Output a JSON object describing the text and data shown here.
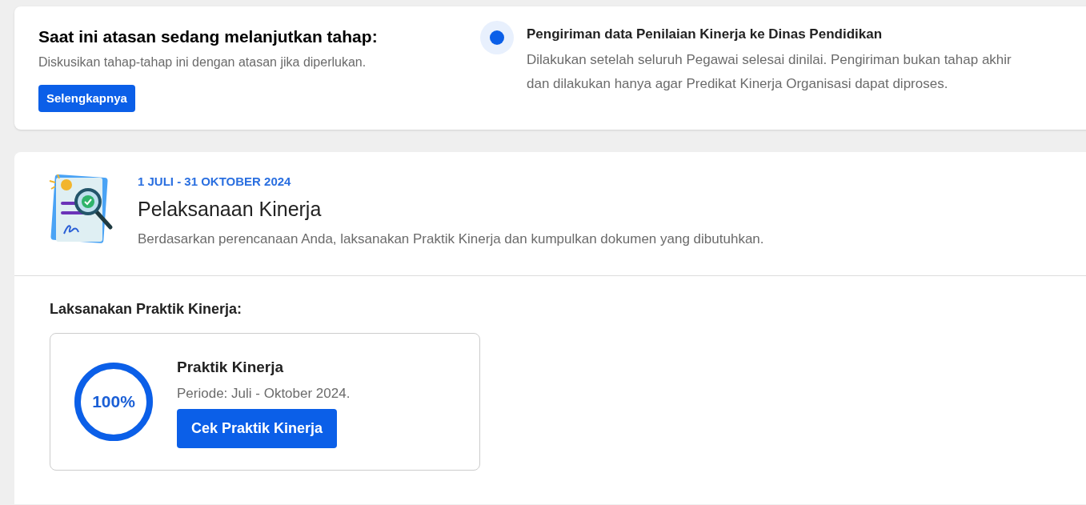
{
  "stage_notice": {
    "title": "Saat ini atasan sedang melanjutkan tahap:",
    "subtitle": "Diskusikan tahap-tahap ini dengan atasan jika diperlukan.",
    "button": "Selengkapnya",
    "current_step": {
      "selected": true,
      "title": "Pengiriman data Penilaian Kinerja ke Dinas Pendidikan",
      "description": "Dilakukan setelah seluruh Pegawai selesai dinilai. Pengiriman bukan tahap akhir dan dilakukan hanya agar Predikat Kinerja Organisasi dapat diproses."
    }
  },
  "phase": {
    "dates": "1 JULI - 31 OKTOBER 2024",
    "title": "Pelaksanaan Kinerja",
    "description": "Berdasarkan perencanaan Anda, laksanakan Praktik Kinerja dan kumpulkan dokumen yang dibutuhkan.",
    "section_title": "Laksanakan Praktik Kinerja:",
    "practice": {
      "level": 1,
      "percent": "100%",
      "title": "Praktik Kinerja",
      "period": "Periode: Juli - Oktober 2024.",
      "button": "Cek Praktik Kinerja"
    }
  }
}
